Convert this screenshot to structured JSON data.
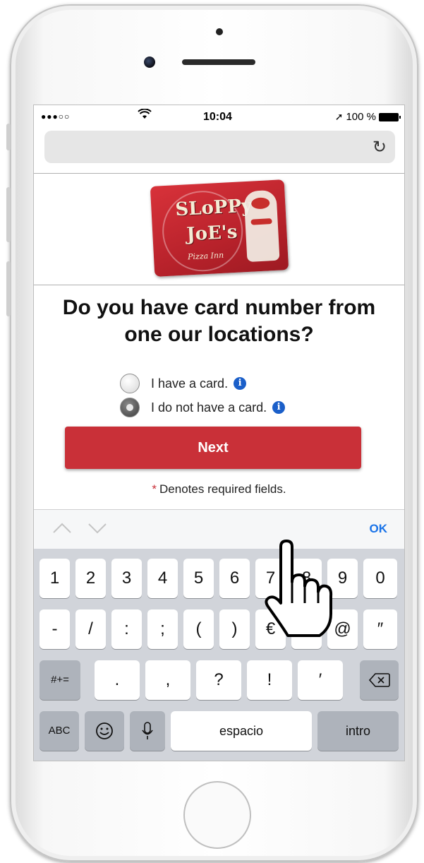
{
  "status_bar": {
    "signal": "●●●○○",
    "time": "10:04",
    "battery_text": "100 %"
  },
  "browser": {
    "reload_icon": "↻"
  },
  "card": {
    "line1": "SLoPPy",
    "line2": "JoE's",
    "subtitle": "Pizza Inn"
  },
  "question": {
    "line1": "Do you have card number from",
    "line2": "one our locations?"
  },
  "options": [
    {
      "label": "I have a card.",
      "checked": false
    },
    {
      "label": "I do not have a card.",
      "checked": true
    }
  ],
  "next_label": "Next",
  "required_text": "Denotes required fields.",
  "required_star": "*",
  "keyboard": {
    "ok_label": "OK",
    "row1": [
      "1",
      "2",
      "3",
      "4",
      "5",
      "6",
      "7",
      "8",
      "9",
      "0"
    ],
    "row2": [
      "-",
      "/",
      ":",
      ";",
      "(",
      ")",
      "€",
      "&",
      "@",
      "″"
    ],
    "row3_left": "#+=",
    "row3": [
      ".",
      ",",
      "?",
      "!",
      "′"
    ],
    "abc": "ABC",
    "space": "espacio",
    "intro": "intro"
  },
  "colors": {
    "accent_red": "#c93038",
    "info_blue": "#1b5fc9",
    "ok_blue": "#1a73e8"
  }
}
